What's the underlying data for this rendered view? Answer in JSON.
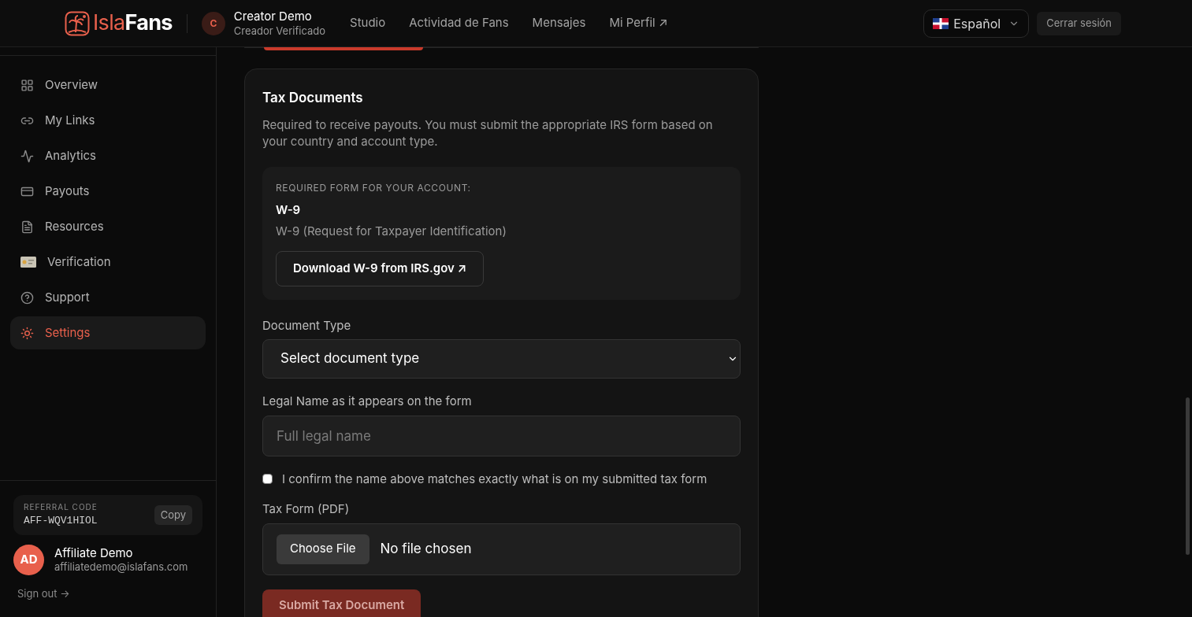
{
  "header": {
    "brand_prefix": "Isla",
    "brand_suffix": "Fans",
    "user": {
      "initial": "C",
      "name": "Creator Demo",
      "role": "Creador Verificado"
    },
    "nav": [
      "Studio",
      "Actividad de Fans",
      "Mensajes",
      "Mi Perfil ↗"
    ],
    "language": "Español",
    "logout": "Cerrar sesión"
  },
  "sidebar": {
    "items": [
      {
        "label": "Overview",
        "selected": false
      },
      {
        "label": "My Links",
        "selected": false
      },
      {
        "label": "Analytics",
        "selected": false
      },
      {
        "label": "Payouts",
        "selected": false
      },
      {
        "label": "Resources",
        "selected": false
      },
      {
        "label": "Verification",
        "selected": false
      },
      {
        "label": "Support",
        "selected": false
      },
      {
        "label": "Settings",
        "selected": true
      }
    ],
    "referral": {
      "label": "REFERRAL CODE",
      "code": "AFF-WQV1HIOL",
      "copy": "Copy"
    },
    "account": {
      "initials": "AD",
      "name": "Affiliate Demo",
      "email": "affiliatedemo@islafans.com"
    },
    "sign_out": "Sign out →"
  },
  "tax": {
    "title": "Tax Documents",
    "description": "Required to receive payouts. You must submit the appropriate IRS form based on your country and account type.",
    "required": {
      "label": "REQUIRED FORM FOR YOUR ACCOUNT:",
      "form": "W-9",
      "form_name": "W-9 (Request for Taxpayer Identification)",
      "download": "Download W-9 from IRS.gov ↗"
    },
    "document_type": {
      "label": "Document Type",
      "value": "Select document type"
    },
    "legal_name": {
      "label": "Legal Name as it appears on the form",
      "placeholder": "Full legal name"
    },
    "confirm": {
      "label": "I confirm the name above matches exactly what is on my submitted tax form",
      "checked": false
    },
    "file": {
      "label": "Tax Form (PDF)",
      "button": "Choose File",
      "status": "No file chosen"
    },
    "submit": "Submit Tax Document"
  }
}
